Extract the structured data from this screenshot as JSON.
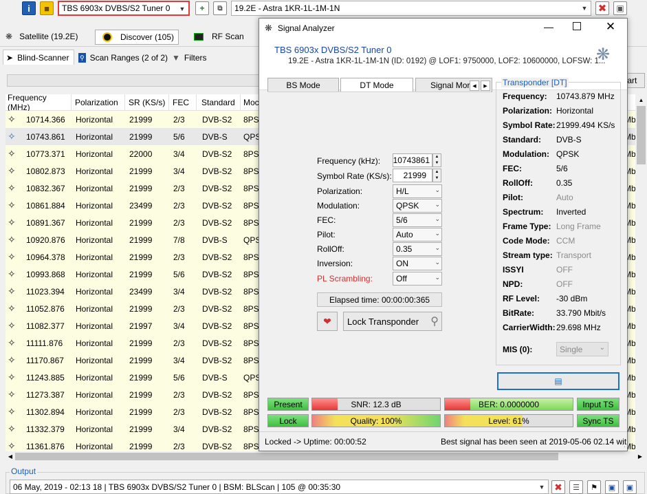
{
  "toolbar": {
    "tuner": "TBS 6903x DVBS/S2 Tuner 0",
    "satellite": "19.2E - Astra 1KR-1L-1M-1N"
  },
  "tabs_top": {
    "satellite": "Satellite (19.2E)",
    "discover": "Discover (105)",
    "rfscan": "RF Scan"
  },
  "tabs_sub": {
    "blind": "Blind-Scanner",
    "ranges": "Scan Ranges (2 of 2)",
    "filters": "Filters"
  },
  "start_label": "tart",
  "grid": {
    "headers": [
      "Frequency (MHz)",
      "Polarization",
      "SR (KS/s)",
      "FEC",
      "Standard",
      "Moc"
    ],
    "rows": [
      [
        "10714.366",
        "Horizontal",
        "21999",
        "2/3",
        "DVB-S2",
        "8PSK"
      ],
      [
        "10743.861",
        "Horizontal",
        "21999",
        "5/6",
        "DVB-S",
        "QPSK"
      ],
      [
        "10773.371",
        "Horizontal",
        "22000",
        "3/4",
        "DVB-S2",
        "8PSK"
      ],
      [
        "10802.873",
        "Horizontal",
        "21999",
        "3/4",
        "DVB-S2",
        "8PSK"
      ],
      [
        "10832.367",
        "Horizontal",
        "21999",
        "2/3",
        "DVB-S2",
        "8PSK"
      ],
      [
        "10861.884",
        "Horizontal",
        "23499",
        "2/3",
        "DVB-S2",
        "8PSK"
      ],
      [
        "10891.367",
        "Horizontal",
        "21999",
        "2/3",
        "DVB-S2",
        "8PSK"
      ],
      [
        "10920.876",
        "Horizontal",
        "21999",
        "7/8",
        "DVB-S",
        "QPSK"
      ],
      [
        "10964.378",
        "Horizontal",
        "21999",
        "2/3",
        "DVB-S2",
        "8PSK"
      ],
      [
        "10993.868",
        "Horizontal",
        "21999",
        "5/6",
        "DVB-S2",
        "8PSK"
      ],
      [
        "11023.394",
        "Horizontal",
        "23499",
        "3/4",
        "DVB-S2",
        "8PSK"
      ],
      [
        "11052.876",
        "Horizontal",
        "21999",
        "2/3",
        "DVB-S2",
        "8PSK"
      ],
      [
        "11082.377",
        "Horizontal",
        "21997",
        "3/4",
        "DVB-S2",
        "8PSK"
      ],
      [
        "11111.876",
        "Horizontal",
        "21999",
        "2/3",
        "DVB-S2",
        "8PSK"
      ],
      [
        "11170.867",
        "Horizontal",
        "21999",
        "3/4",
        "DVB-S2",
        "8PSK"
      ],
      [
        "11243.885",
        "Horizontal",
        "21999",
        "5/6",
        "DVB-S",
        "QPSK"
      ],
      [
        "11273.387",
        "Horizontal",
        "21999",
        "2/3",
        "DVB-S2",
        "8PSK"
      ],
      [
        "11302.894",
        "Horizontal",
        "21999",
        "2/3",
        "DVB-S2",
        "8PSK"
      ],
      [
        "11332.379",
        "Horizontal",
        "21999",
        "3/4",
        "DVB-S2",
        "8PSK"
      ],
      [
        "11361.876",
        "Horizontal",
        "21999",
        "2/3",
        "DVB-S2",
        "8PSK"
      ]
    ],
    "right_col": "Mb"
  },
  "analyzer": {
    "title": "Signal Analyzer",
    "tuner": "TBS 6903x DVBS/S2 Tuner 0",
    "info": "19.2E - Astra 1KR-1L-1M-1N (ID: 0192) @ LOF1: 9750000, LOF2: 10600000, LOFSW: 1...",
    "modes": [
      "BS Mode",
      "DT Mode",
      "Signal Mor"
    ],
    "fields": {
      "frequency_label": "Frequency (kHz):",
      "frequency_value": "10743861",
      "sr_label": "Symbol Rate (KS/s):",
      "sr_value": "21999",
      "pol_label": "Polarization:",
      "pol_value": "H/L",
      "mod_label": "Modulation:",
      "mod_value": "QPSK",
      "fec_label": "FEC:",
      "fec_value": "5/6",
      "pilot_label": "Pilot:",
      "pilot_value": "Auto",
      "rolloff_label": "RollOff:",
      "rolloff_value": "0.35",
      "inversion_label": "Inversion:",
      "inversion_value": "ON",
      "pls_label": "PL Scrambling:",
      "pls_value": "Off"
    },
    "elapsed": "Elapsed time: 00:00:00:365",
    "lock_btn": "Lock Transponder",
    "transponder": {
      "heading": "Transponder [DT]",
      "items": [
        {
          "label": "Frequency:",
          "value": "10743.879 MHz"
        },
        {
          "label": "Polarization:",
          "value": "Horizontal"
        },
        {
          "label": "Symbol Rate:",
          "value": "21999.494 KS/s"
        },
        {
          "label": "Standard:",
          "value": "DVB-S"
        },
        {
          "label": "Modulation:",
          "value": "QPSK"
        },
        {
          "label": "FEC:",
          "value": "5/6"
        },
        {
          "label": "RollOff:",
          "value": "0.35"
        },
        {
          "label": "Pilot:",
          "value": "Auto"
        },
        {
          "label": "Spectrum:",
          "value": "Inverted"
        },
        {
          "label": "Frame Type:",
          "value": "Long Frame"
        },
        {
          "label": "Code Mode:",
          "value": "CCM"
        },
        {
          "label": "Stream type:",
          "value": "Transport"
        },
        {
          "label": "ISSYI",
          "value": "OFF"
        },
        {
          "label": "NPD:",
          "value": "OFF"
        },
        {
          "label": "RF Level:",
          "value": "-30 dBm"
        },
        {
          "label": "BitRate:",
          "value": "33.790 Mbit/s"
        },
        {
          "label": "CarrierWidth:",
          "value": "29.698 MHz"
        }
      ],
      "mis_label": "MIS (0):",
      "mis_value": "Single"
    },
    "status": {
      "present": "Present",
      "snr": "SNR: 12.3 dB",
      "ber": "BER: 0.0000000",
      "input_ts": "Input TS",
      "lock": "Lock",
      "quality": "Quality: 100%",
      "level": "Level: 61%",
      "sync_ts": "Sync TS"
    },
    "meters": {
      "snr_fill": 0.2,
      "ber_fill": 0.2,
      "quality_fill": 1.0,
      "level_fill": 0.61
    },
    "footer_left": "Locked -> Uptime: 00:00:52",
    "footer_right": "Best signal has been seen at 2019-05-06 02.14 wit"
  },
  "output": {
    "label": "Output",
    "text": "06 May, 2019 - 02:13 18 | TBS 6903x DVBS/S2 Tuner 0 | BSM: BLScan | 105 @ 00:35:30"
  }
}
